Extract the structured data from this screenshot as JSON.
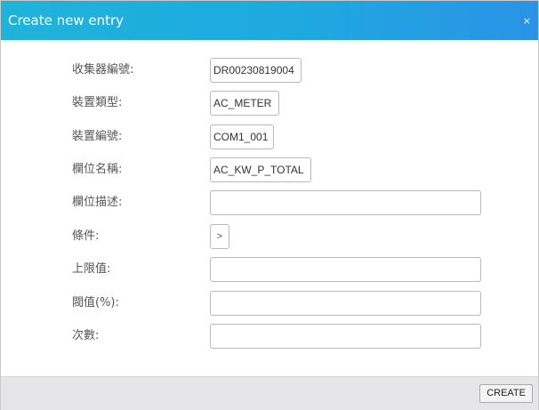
{
  "dialog": {
    "title": "Create new entry",
    "close_glyph": "×"
  },
  "form": {
    "collector_id": {
      "label": "收集器編號:",
      "value": "DR00230819004"
    },
    "device_type": {
      "label": "裝置類型:",
      "value": "AC_METER"
    },
    "device_id": {
      "label": "裝置編號:",
      "value": "COM1_001"
    },
    "field_name": {
      "label": "欄位名稱:",
      "value": "AC_KW_P_TOTAL"
    },
    "field_desc": {
      "label": "欄位描述:",
      "value": ""
    },
    "condition": {
      "label": "條件:",
      "value": ">"
    },
    "upper_limit": {
      "label": "上限值:",
      "value": ""
    },
    "threshold": {
      "label": "閥值(%):",
      "value": ""
    },
    "count": {
      "label": "次數:",
      "value": ""
    }
  },
  "footer": {
    "create_label": "CREATE"
  },
  "colors": {
    "title_gradient_start": "#1fb3d9",
    "title_gradient_end": "#2a93e6",
    "footer_bg": "#e6e6e8"
  }
}
